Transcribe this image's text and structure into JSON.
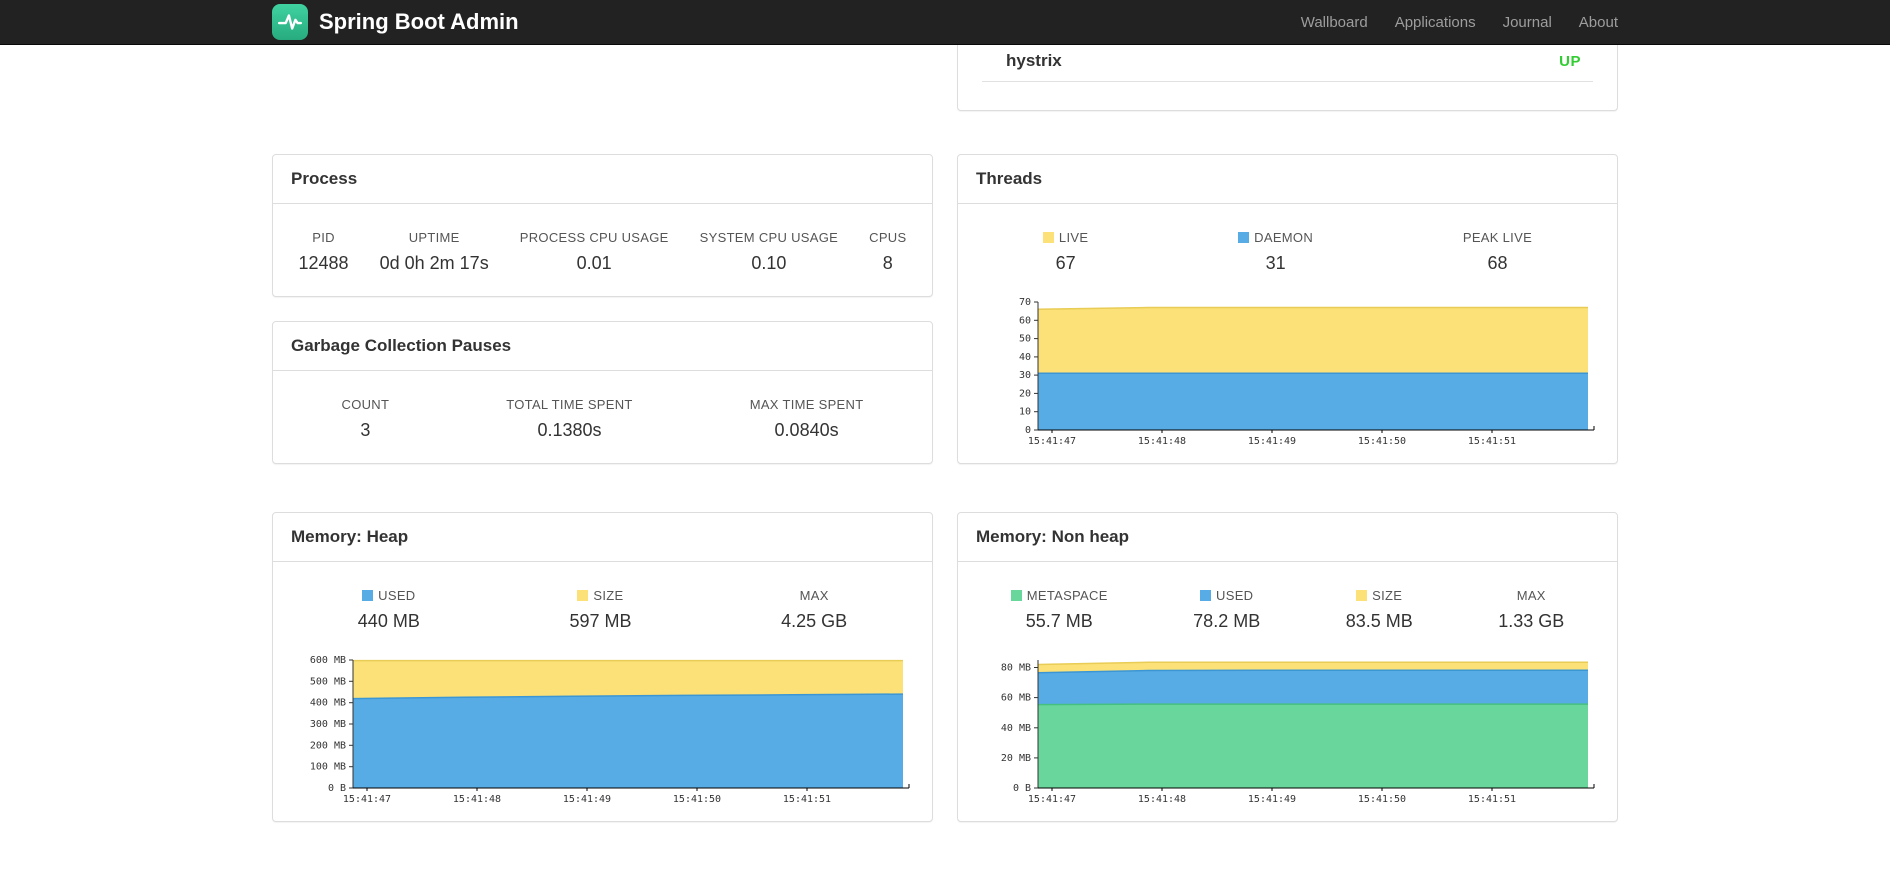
{
  "navbar": {
    "brand": "Spring Boot Admin",
    "items": [
      {
        "label": "Wallboard"
      },
      {
        "label": "Applications"
      },
      {
        "label": "Journal"
      },
      {
        "label": "About"
      }
    ]
  },
  "app_panel": {
    "name": "hystrix",
    "status": "UP",
    "status_color": "#32CD32"
  },
  "panels": {
    "process": {
      "title": "Process",
      "stats": [
        {
          "label": "PID",
          "value": "12488"
        },
        {
          "label": "UPTIME",
          "value": "0d 0h 2m 17s"
        },
        {
          "label": "PROCESS CPU USAGE",
          "value": "0.01"
        },
        {
          "label": "SYSTEM CPU USAGE",
          "value": "0.10"
        },
        {
          "label": "CPUS",
          "value": "8"
        }
      ]
    },
    "gc": {
      "title": "Garbage Collection Pauses",
      "stats": [
        {
          "label": "COUNT",
          "value": "3"
        },
        {
          "label": "TOTAL TIME SPENT",
          "value": "0.1380s"
        },
        {
          "label": "MAX TIME SPENT",
          "value": "0.0840s"
        }
      ]
    },
    "threads": {
      "title": "Threads",
      "stats": [
        {
          "label": "LIVE",
          "value": "67",
          "swatch": "#FBE178"
        },
        {
          "label": "DAEMON",
          "value": "31",
          "swatch": "#57ACE5"
        },
        {
          "label": "PEAK LIVE",
          "value": "68"
        }
      ]
    },
    "heap": {
      "title": "Memory: Heap",
      "stats": [
        {
          "label": "USED",
          "value": "440 MB",
          "swatch": "#57ACE5"
        },
        {
          "label": "SIZE",
          "value": "597 MB",
          "swatch": "#FBE178"
        },
        {
          "label": "MAX",
          "value": "4.25 GB"
        }
      ]
    },
    "nonheap": {
      "title": "Memory: Non heap",
      "stats": [
        {
          "label": "METASPACE",
          "value": "55.7 MB",
          "swatch": "#69D79C"
        },
        {
          "label": "USED",
          "value": "78.2 MB",
          "swatch": "#57ACE5"
        },
        {
          "label": "SIZE",
          "value": "83.5 MB",
          "swatch": "#FBE178"
        },
        {
          "label": "MAX",
          "value": "1.33 GB"
        }
      ]
    }
  },
  "chart_data": [
    {
      "id": "threads",
      "type": "area",
      "stacked": true,
      "stacking": "values are cumulative stack tops",
      "title": "Threads",
      "x_ticks": [
        "15:41:47",
        "15:41:48",
        "15:41:49",
        "15:41:50",
        "15:41:51"
      ],
      "ylim": [
        0,
        70
      ],
      "y_ticks": [
        {
          "v": 0,
          "label": "0"
        },
        {
          "v": 10,
          "label": "10"
        },
        {
          "v": 20,
          "label": "20"
        },
        {
          "v": 30,
          "label": "30"
        },
        {
          "v": 40,
          "label": "40"
        },
        {
          "v": 50,
          "label": "50"
        },
        {
          "v": 60,
          "label": "60"
        },
        {
          "v": 70,
          "label": "70"
        }
      ],
      "series": [
        {
          "name": "LIVE",
          "color": "#FBE178",
          "stroke": "#E9CC55",
          "values": [
            66,
            67,
            67,
            67,
            67,
            67
          ]
        },
        {
          "name": "DAEMON",
          "color": "#57ACE5",
          "stroke": "#3C96D4",
          "values": [
            31,
            31,
            31,
            31,
            31,
            31
          ]
        }
      ]
    },
    {
      "id": "heap",
      "type": "area",
      "stacked": true,
      "stacking": "values are cumulative stack tops",
      "title": "Memory: Heap",
      "x_ticks": [
        "15:41:47",
        "15:41:48",
        "15:41:49",
        "15:41:50",
        "15:41:51"
      ],
      "ylim": [
        0,
        600
      ],
      "y_ticks": [
        {
          "v": 0,
          "label": "0 B"
        },
        {
          "v": 100,
          "label": "100 MB"
        },
        {
          "v": 200,
          "label": "200 MB"
        },
        {
          "v": 300,
          "label": "300 MB"
        },
        {
          "v": 400,
          "label": "400 MB"
        },
        {
          "v": 500,
          "label": "500 MB"
        },
        {
          "v": 600,
          "label": "600 MB"
        }
      ],
      "series": [
        {
          "name": "SIZE",
          "color": "#FBE178",
          "stroke": "#E9CC55",
          "values": [
            597,
            597,
            597,
            597,
            597,
            597
          ]
        },
        {
          "name": "USED",
          "color": "#57ACE5",
          "stroke": "#3C96D4",
          "values": [
            419,
            425,
            430,
            434,
            437,
            440
          ]
        }
      ]
    },
    {
      "id": "nonheap",
      "type": "area",
      "stacked": true,
      "stacking": "values are cumulative stack tops",
      "title": "Memory: Non heap",
      "x_ticks": [
        "15:41:47",
        "15:41:48",
        "15:41:49",
        "15:41:50",
        "15:41:51"
      ],
      "ylim": [
        0,
        85
      ],
      "y_ticks": [
        {
          "v": 0,
          "label": "0 B"
        },
        {
          "v": 20,
          "label": "20 MB"
        },
        {
          "v": 40,
          "label": "40 MB"
        },
        {
          "v": 60,
          "label": "60 MB"
        },
        {
          "v": 80,
          "label": "80 MB"
        }
      ],
      "series": [
        {
          "name": "SIZE",
          "color": "#FBE178",
          "stroke": "#E9CC55",
          "values": [
            82,
            83.5,
            83.5,
            83.5,
            83.5,
            83.5
          ]
        },
        {
          "name": "USED",
          "color": "#57ACE5",
          "stroke": "#3C96D4",
          "values": [
            76.5,
            78,
            78.2,
            78.2,
            78.2,
            78.2
          ]
        },
        {
          "name": "METASPACE",
          "color": "#69D79C",
          "stroke": "#46C07F",
          "values": [
            55.4,
            55.7,
            55.7,
            55.7,
            55.7,
            55.7
          ]
        }
      ]
    }
  ]
}
